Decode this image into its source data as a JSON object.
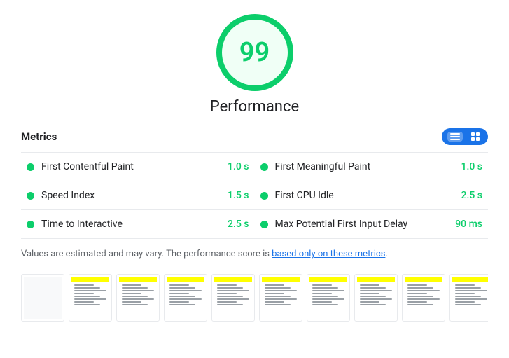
{
  "score": {
    "value": "99",
    "label": "Performance"
  },
  "metrics_header": {
    "title": "Metrics"
  },
  "toggle": {
    "list_label": "List view",
    "grid_label": "Grid view"
  },
  "metrics": [
    {
      "name": "First Contentful Paint",
      "value": "1.0 s",
      "color": "#0cce6b"
    },
    {
      "name": "First Meaningful Paint",
      "value": "1.0 s",
      "color": "#0cce6b"
    },
    {
      "name": "Speed Index",
      "value": "1.5 s",
      "color": "#0cce6b"
    },
    {
      "name": "First CPU Idle",
      "value": "2.5 s",
      "color": "#0cce6b"
    },
    {
      "name": "Time to Interactive",
      "value": "2.5 s",
      "color": "#0cce6b"
    },
    {
      "name": "Max Potential First Input Delay",
      "value": "90 ms",
      "color": "#0cce6b"
    }
  ],
  "footer": {
    "text_before": "Values are estimated and may vary. The performance score is ",
    "link_text": "based only on these metrics",
    "text_after": "."
  },
  "filmstrip": {
    "frames": [
      {
        "type": "blank"
      },
      {
        "type": "content"
      },
      {
        "type": "content"
      },
      {
        "type": "content"
      },
      {
        "type": "content"
      },
      {
        "type": "content"
      },
      {
        "type": "content"
      },
      {
        "type": "content"
      },
      {
        "type": "content"
      },
      {
        "type": "content"
      },
      {
        "type": "content"
      }
    ]
  }
}
